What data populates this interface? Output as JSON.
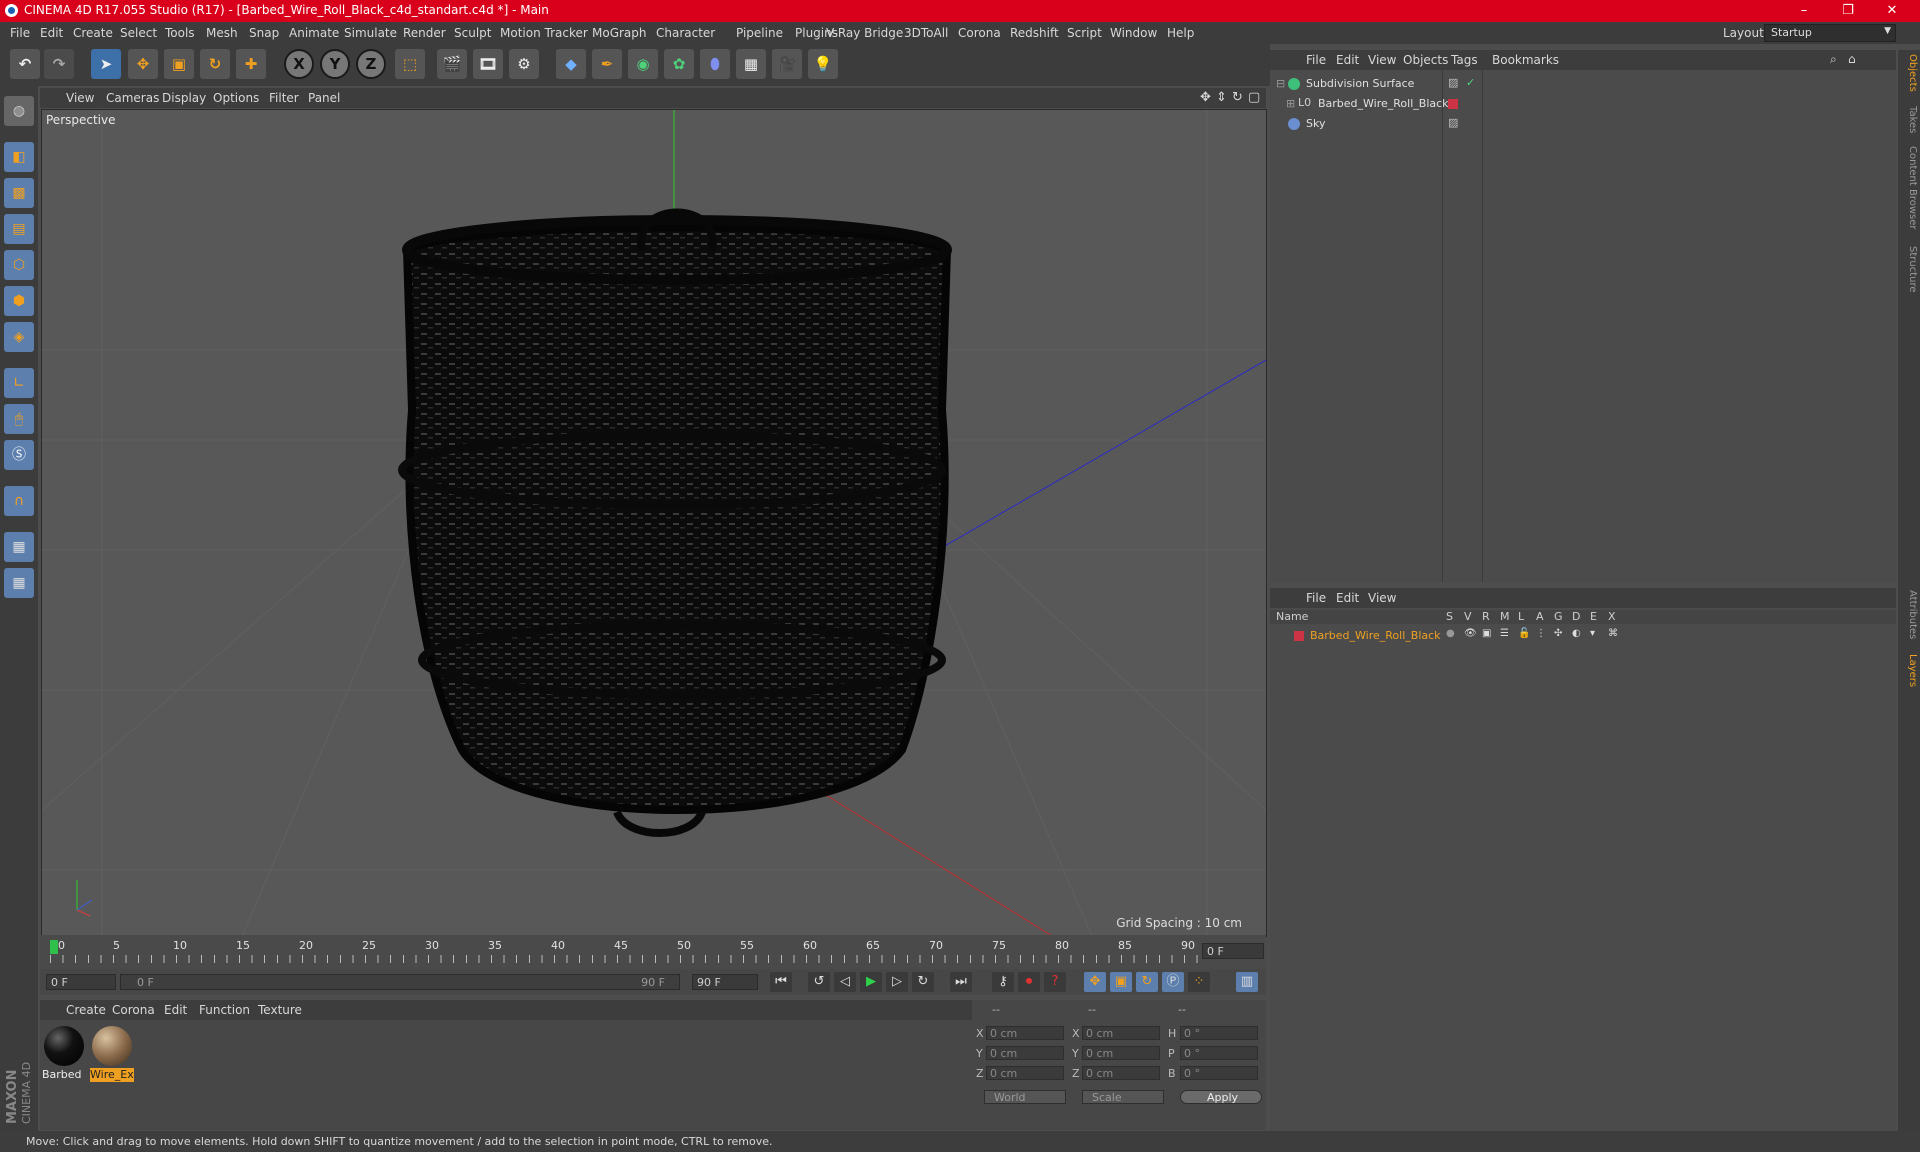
{
  "window": {
    "title": "CINEMA 4D R17.055 Studio (R17) - [Barbed_Wire_Roll_Black_c4d_standart.c4d *] - Main",
    "minimize": "–",
    "maximize": "❐",
    "close": "✕"
  },
  "menu": [
    "File",
    "Edit",
    "Create",
    "Select",
    "Tools",
    "Mesh",
    "Snap",
    "Animate",
    "Simulate",
    "Render",
    "Sculpt",
    "Motion Tracker",
    "MoGraph",
    "Character",
    "Pipeline",
    "Plugins",
    "V-Ray Bridge",
    "3DToAll",
    "Corona",
    "Redshift",
    "Script",
    "Window",
    "Help"
  ],
  "layout": {
    "label": "Layout:",
    "value": "Startup"
  },
  "toolbar": {
    "axis_x": "X",
    "axis_y": "Y",
    "axis_z": "Z"
  },
  "viewport": {
    "menu": [
      "View",
      "Cameras",
      "Display",
      "Options",
      "Filter",
      "Panel"
    ],
    "label": "Perspective",
    "grid_spacing": "Grid Spacing : 10 cm"
  },
  "timeline": {
    "ticks": [
      "0",
      "5",
      "10",
      "15",
      "20",
      "25",
      "30",
      "35",
      "40",
      "45",
      "50",
      "55",
      "60",
      "65",
      "70",
      "75",
      "80",
      "85",
      "90"
    ],
    "current_frame": "0 F",
    "start_field": "0 F",
    "range_start": "0 F",
    "range_end": "90 F",
    "end_field": "90 F"
  },
  "materials": {
    "menu": [
      "Create",
      "Corona",
      "Edit",
      "Function",
      "Texture"
    ],
    "items": [
      {
        "name": "Barbed",
        "color": "#111111",
        "selected": false
      },
      {
        "name": "Wire_Ex",
        "color": "#8a6a4a",
        "selected": true
      }
    ]
  },
  "coords": {
    "header": [
      "--",
      "--",
      "--"
    ],
    "rows": [
      {
        "a": "X",
        "av": "0 cm",
        "b": "X",
        "bv": "0 cm",
        "c": "H",
        "cv": "0 °"
      },
      {
        "a": "Y",
        "av": "0 cm",
        "b": "Y",
        "bv": "0 cm",
        "c": "P",
        "cv": "0 °"
      },
      {
        "a": "Z",
        "av": "0 cm",
        "b": "Z",
        "bv": "0 cm",
        "c": "B",
        "cv": "0 °"
      }
    ],
    "world": "World",
    "scale": "Scale",
    "apply": "Apply"
  },
  "objects": {
    "menu": [
      "File",
      "Edit",
      "View",
      "Objects",
      "Tags",
      "Bookmarks"
    ],
    "items": [
      {
        "name": "Subdivision Surface",
        "color": "#3fc07a"
      },
      {
        "name": "Barbed_Wire_Roll_Black",
        "color": "#9aa0a6"
      },
      {
        "name": "Sky",
        "color": "#6a8fd0"
      }
    ]
  },
  "layers": {
    "menu": [
      "File",
      "Edit",
      "View"
    ],
    "columns": [
      "Name",
      "S",
      "V",
      "R",
      "M",
      "L",
      "A",
      "G",
      "D",
      "E",
      "X"
    ],
    "items": [
      {
        "name": "Barbed_Wire_Roll_Black",
        "color": "#cc3344"
      }
    ]
  },
  "side_tabs": [
    "Objects",
    "Takes",
    "Content Browser",
    "Structure",
    "Attributes",
    "Layers"
  ],
  "status": "Move: Click and drag to move elements. Hold down SHIFT to quantize movement / add to the selection in point mode, CTRL to remove."
}
